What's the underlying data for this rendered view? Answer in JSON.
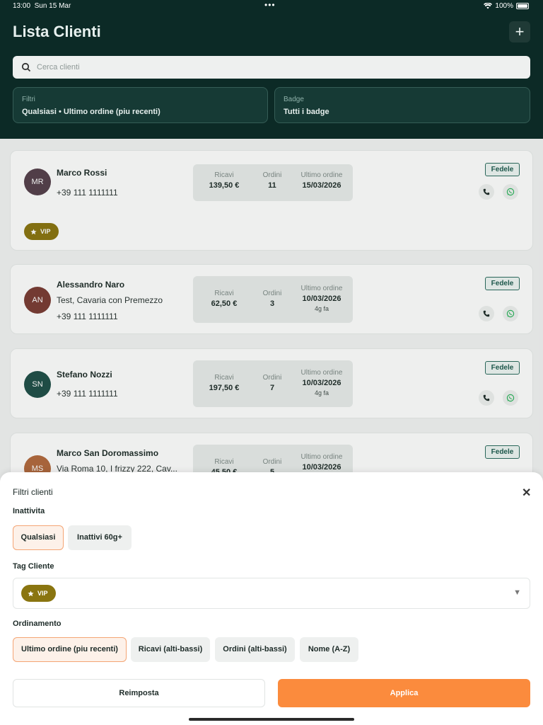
{
  "status": {
    "time": "13:00",
    "date": "Sun 15 Mar",
    "dots": "•••",
    "battery": "100%"
  },
  "header": {
    "title": "Lista Clienti",
    "add_label": "+",
    "search_placeholder": "Cerca clienti",
    "filters_label": "Filtri",
    "filters_value": "Qualsiasi • Ultimo ordine (piu recenti)",
    "badge_label": "Badge",
    "badge_value": "Tutti i badge"
  },
  "stat_labels": {
    "revenue": "Ricavi",
    "orders": "Ordini",
    "last_order": "Ultimo ordine"
  },
  "customers": [
    {
      "initials": "MR",
      "name": "Marco Rossi",
      "phone": "+39 111 1111111",
      "revenue": "139,50 €",
      "orders": "11",
      "last_order": "15/03/2026",
      "badge": "Fedele",
      "tag": "VIP",
      "color": "#553f4b"
    },
    {
      "initials": "AN",
      "name": "Alessandro Naro",
      "address": "Test, Cavaria con Premezzo",
      "phone": "+39 111 1111111",
      "revenue": "62,50 €",
      "orders": "3",
      "last_order": "10/03/2026",
      "last_order_ago": "4g fa",
      "badge": "Fedele",
      "color": "#7a3b34"
    },
    {
      "initials": "SN",
      "name": "Stefano Nozzi",
      "phone": "+39 111 1111111",
      "revenue": "197,50 €",
      "orders": "7",
      "last_order": "10/03/2026",
      "last_order_ago": "4g fa",
      "badge": "Fedele",
      "color": "#1f4f48"
    },
    {
      "initials": "MS",
      "name": "Marco San Doromassimo",
      "address": "Via Roma 10, I frizzy 222, Cav...",
      "revenue": "45,50 €",
      "orders": "5",
      "last_order": "10/03/2026",
      "badge": "Fedele",
      "color": "#b2693d"
    }
  ],
  "sheet": {
    "title": "Filtri clienti",
    "close": "✕",
    "inactivity_label": "Inattivita",
    "inactivity_options": [
      "Qualsiasi",
      "Inattivi 60g+"
    ],
    "tag_label": "Tag Cliente",
    "tag_selected": "VIP",
    "sort_label": "Ordinamento",
    "sort_options": [
      "Ultimo ordine (piu recenti)",
      "Ricavi (alti-bassi)",
      "Ordini (alti-bassi)",
      "Nome (A-Z)"
    ],
    "reset_label": "Reimposta",
    "apply_label": "Applica"
  },
  "colors": {
    "header_bg": "#0c2a26",
    "accent": "#fb8b3d",
    "vip": "#8a7510",
    "badge_green": "#2a6b5e"
  }
}
